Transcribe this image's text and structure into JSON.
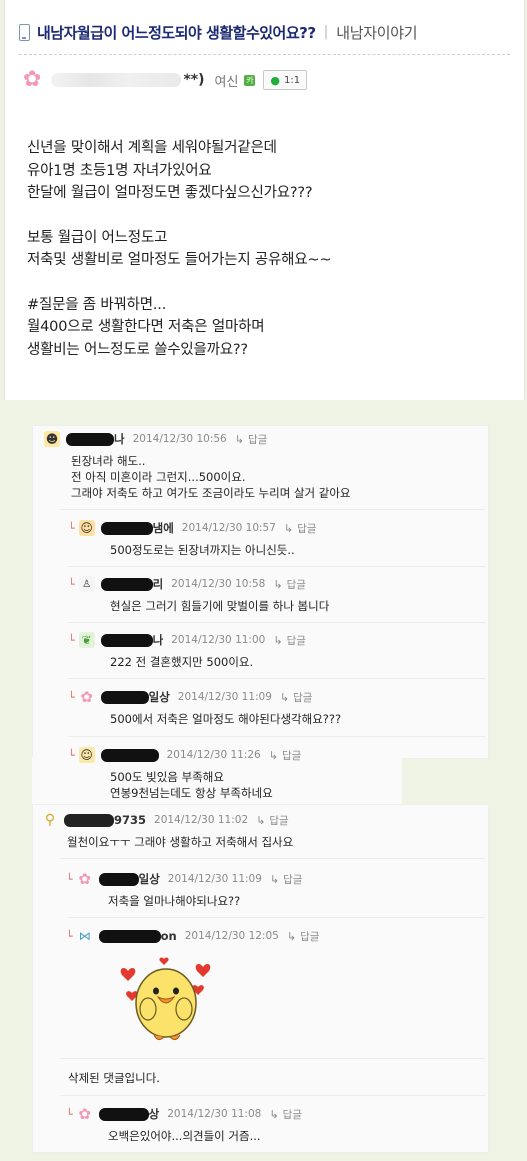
{
  "post": {
    "title": "내남자월급이 어느정도되야 생활할수있어요??",
    "board": "내남자이야기",
    "author_suffix": "**)",
    "rank": "여신",
    "cafe_badge": "카",
    "chat_count": "1:1",
    "body_lines": [
      "신년을 맞이해서 계획을 세워야될거같은데",
      "유아1명 초등1명 자녀가있어요",
      "한달에 월급이 얼마정도면 좋겠다싶으신가요???",
      "",
      "보통 월급이 어느정도고",
      "저축및 생활비로 얼마정도 들어가는지 공유해요~~",
      "",
      "#질문을 좀 바꿔하면...",
      "월400으로 생활한다면 저축은 얼마하며",
      "생활비는 어느정도로 쓸수있을까요??"
    ]
  },
  "reply_label": "답글",
  "comments": [
    {
      "nick_suffix": "나",
      "date": "2014/12/30 10:56",
      "lines": [
        "된장녀라 해도..",
        "전 아직 미혼이라 그런지...500이요.",
        "그래야 저축도 하고 여가도 조금이라도 누리며 살거 같아요"
      ]
    },
    {
      "nick_suffix": "냄에",
      "date": "2014/12/30 10:57",
      "lines": [
        "500정도로는 된장녀까지는 아니신듯.."
      ]
    },
    {
      "nick_suffix": "리",
      "date": "2014/12/30 10:58",
      "lines": [
        "현실은 그러기 힘들기에 맞벌이를 하나 봅니다"
      ]
    },
    {
      "nick_suffix": "나",
      "date": "2014/12/30 11:00",
      "lines": [
        "222 전 결혼했지만 500이요."
      ]
    },
    {
      "nick_suffix": "일상",
      "date": "2014/12/30 11:09",
      "lines": [
        "500에서 저축은 얼마정도 해야된다생각해요???"
      ]
    },
    {
      "nick_suffix": "",
      "date": "2014/12/30 11:26",
      "lines": [
        "500도 빚있음 부족해요",
        "연봉9천넘는데도 항상 부족하네요"
      ]
    },
    {
      "nick_suffix": "9735",
      "date": "2014/12/30 11:02",
      "lines": [
        "월천이요ㅜㅜ 그래야 생활하고 저축해서 집사요"
      ]
    },
    {
      "nick_suffix": "일상",
      "date": "2014/12/30 11:09",
      "lines": [
        "저축을 얼마나해야되나요??"
      ]
    },
    {
      "nick_suffix": "on",
      "date": "2014/12/30 12:05",
      "lines": []
    },
    {
      "nick_suffix": "상",
      "date": "2014/12/30 11:08",
      "lines": [
        "오백은있어야...의견들이 거즘..."
      ]
    }
  ],
  "deleted_comment": "삭제된 댓글입니다.",
  "icons": {
    "title": "mobile-phone-icon",
    "author_avatar": "pink-flower-icon",
    "chat": "chat-bubble-icon",
    "reply_arrow": "reply-arrow-icon",
    "sticker": "duck-sticker-with-hearts"
  },
  "colors": {
    "title": "#1b2a72",
    "background": "#eef3e4",
    "reply_arrow": "#e06b6b",
    "date": "#8a8a8a"
  }
}
